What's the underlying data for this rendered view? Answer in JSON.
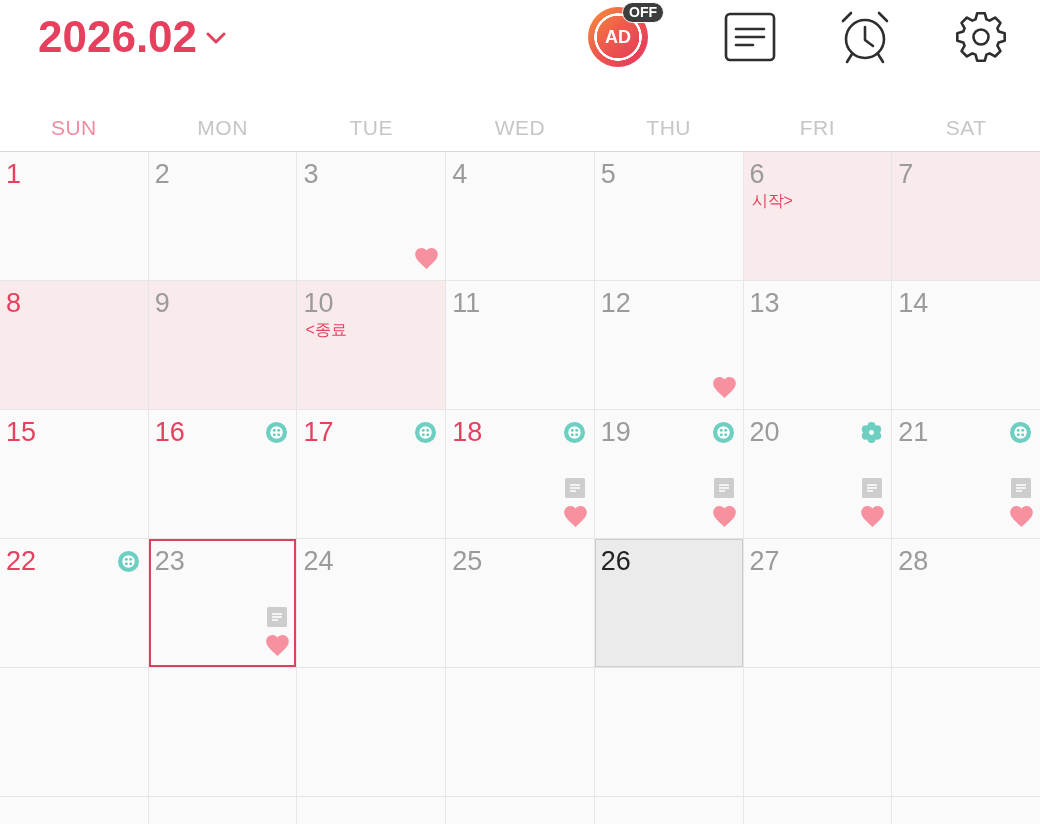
{
  "header": {
    "title": "2026.02",
    "ad_button": {
      "label": "AD",
      "badge": "OFF"
    }
  },
  "weekdays": [
    {
      "label": "SUN",
      "kind": "sunday"
    },
    {
      "label": "MON",
      "kind": "weekday"
    },
    {
      "label": "TUE",
      "kind": "weekday"
    },
    {
      "label": "WED",
      "kind": "weekday"
    },
    {
      "label": "THU",
      "kind": "weekday"
    },
    {
      "label": "FRI",
      "kind": "weekday"
    },
    {
      "label": "SAT",
      "kind": "weekday"
    }
  ],
  "weeks": [
    [
      {
        "day": "1",
        "holiday": true,
        "period": false,
        "today": false,
        "selected": false,
        "note": false,
        "heart": false
      },
      {
        "day": "2",
        "holiday": false,
        "period": false,
        "today": false,
        "selected": false,
        "note": false,
        "heart": false
      },
      {
        "day": "3",
        "holiday": false,
        "period": false,
        "today": false,
        "selected": false,
        "note": false,
        "heart": true
      },
      {
        "day": "4",
        "holiday": false,
        "period": false,
        "today": false,
        "selected": false,
        "note": false,
        "heart": false
      },
      {
        "day": "5",
        "holiday": false,
        "period": false,
        "today": false,
        "selected": false,
        "note": false,
        "heart": false
      },
      {
        "day": "6",
        "holiday": false,
        "period": true,
        "today": false,
        "selected": false,
        "note": false,
        "heart": false,
        "label": "시작>"
      },
      {
        "day": "7",
        "holiday": false,
        "period": true,
        "today": false,
        "selected": false,
        "note": false,
        "heart": false
      }
    ],
    [
      {
        "day": "8",
        "holiday": true,
        "period": true,
        "today": false,
        "selected": false,
        "note": false,
        "heart": false
      },
      {
        "day": "9",
        "holiday": false,
        "period": true,
        "today": false,
        "selected": false,
        "note": false,
        "heart": false
      },
      {
        "day": "10",
        "holiday": false,
        "period": true,
        "today": false,
        "selected": false,
        "note": false,
        "heart": false,
        "label": "<종료"
      },
      {
        "day": "11",
        "holiday": false,
        "period": false,
        "today": false,
        "selected": false,
        "note": false,
        "heart": false
      },
      {
        "day": "12",
        "holiday": false,
        "period": false,
        "today": false,
        "selected": false,
        "note": false,
        "heart": true
      },
      {
        "day": "13",
        "holiday": false,
        "period": false,
        "today": false,
        "selected": false,
        "note": false,
        "heart": false
      },
      {
        "day": "14",
        "holiday": false,
        "period": false,
        "today": false,
        "selected": false,
        "note": false,
        "heart": false
      }
    ],
    [
      {
        "day": "15",
        "holiday": true,
        "period": false,
        "today": false,
        "selected": false,
        "note": false,
        "heart": false
      },
      {
        "day": "16",
        "holiday": true,
        "period": false,
        "today": false,
        "selected": false,
        "note": false,
        "heart": false,
        "marker": {
          "kind": "outline"
        }
      },
      {
        "day": "17",
        "holiday": true,
        "period": false,
        "today": false,
        "selected": false,
        "note": false,
        "heart": false,
        "marker": {
          "kind": "outline"
        }
      },
      {
        "day": "18",
        "holiday": true,
        "period": false,
        "today": false,
        "selected": false,
        "note": true,
        "heart": true,
        "marker": {
          "kind": "outline"
        }
      },
      {
        "day": "19",
        "holiday": false,
        "period": false,
        "today": false,
        "selected": false,
        "note": true,
        "heart": true,
        "marker": {
          "kind": "outline"
        }
      },
      {
        "day": "20",
        "holiday": false,
        "period": false,
        "today": false,
        "selected": false,
        "note": true,
        "heart": true,
        "marker": {
          "kind": "filled"
        }
      },
      {
        "day": "21",
        "holiday": false,
        "period": false,
        "today": false,
        "selected": false,
        "note": true,
        "heart": true,
        "marker": {
          "kind": "outline"
        }
      }
    ],
    [
      {
        "day": "22",
        "holiday": true,
        "period": false,
        "today": false,
        "selected": false,
        "note": false,
        "heart": false,
        "marker": {
          "kind": "outline"
        }
      },
      {
        "day": "23",
        "holiday": false,
        "period": false,
        "today": false,
        "selected": true,
        "note": true,
        "heart": true
      },
      {
        "day": "24",
        "holiday": false,
        "period": false,
        "today": false,
        "selected": false,
        "note": false,
        "heart": false
      },
      {
        "day": "25",
        "holiday": false,
        "period": false,
        "today": false,
        "selected": false,
        "note": false,
        "heart": false
      },
      {
        "day": "26",
        "holiday": false,
        "period": false,
        "today": true,
        "selected": false,
        "note": false,
        "heart": false
      },
      {
        "day": "27",
        "holiday": false,
        "period": false,
        "today": false,
        "selected": false,
        "note": false,
        "heart": false
      },
      {
        "day": "28",
        "holiday": false,
        "period": false,
        "today": false,
        "selected": false,
        "note": false,
        "heart": false
      }
    ]
  ]
}
